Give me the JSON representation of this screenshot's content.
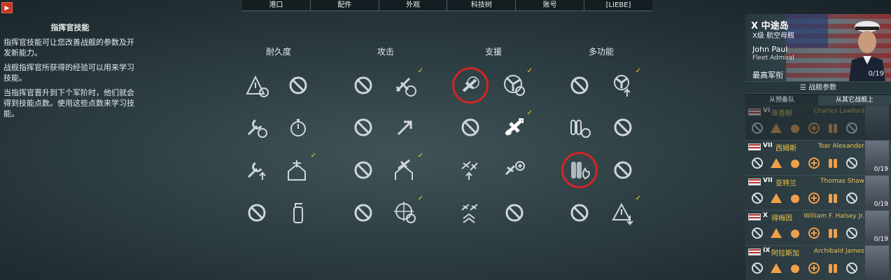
{
  "nav": {
    "back_icon": "▶",
    "tabs": [
      "港口",
      "配件",
      "外观",
      "科技树",
      "账号",
      "[LIEBE]"
    ]
  },
  "info": {
    "title": "指挥官技能",
    "p1": "指挥官技能可让您改善战舰的参数及开发新能力。",
    "p2": "战舰指挥官所获得的经验可以用来学习技能。",
    "p3": "当指挥官晋升到下个军阶时，他们就会得到技能点数。使用这些点数来学习技能。"
  },
  "columns": [
    "耐久度",
    "攻击",
    "支援",
    "多功能"
  ],
  "skills": [
    {
      "icon": "warning-radar-icon",
      "state": "available",
      "check": false
    },
    {
      "icon": "forbidden-icon",
      "state": "locked",
      "check": false
    },
    {
      "icon": "forbidden-icon",
      "state": "locked",
      "check": false
    },
    {
      "icon": "plane-attack-icon",
      "state": "available",
      "check": true
    },
    {
      "icon": "plane-circle-icon",
      "state": "selected",
      "check": false
    },
    {
      "icon": "propeller-icon",
      "state": "available",
      "check": true
    },
    {
      "icon": "forbidden-icon",
      "state": "locked",
      "check": false
    },
    {
      "icon": "propeller-up-icon",
      "state": "available",
      "check": true
    },
    {
      "icon": "wrench-timer-icon",
      "state": "available",
      "check": false
    },
    {
      "icon": "stopwatch-icon",
      "state": "available",
      "check": false
    },
    {
      "icon": "forbidden-icon",
      "state": "locked",
      "check": false
    },
    {
      "icon": "arrow-up-icon",
      "state": "available",
      "check": false
    },
    {
      "icon": "forbidden-icon",
      "state": "locked",
      "check": false
    },
    {
      "icon": "plane-highlight-icon",
      "state": "active",
      "check": true
    },
    {
      "icon": "shells-timer-icon",
      "state": "available",
      "check": false
    },
    {
      "icon": "forbidden-icon",
      "state": "locked",
      "check": false
    },
    {
      "icon": "wrench-up-icon",
      "state": "available",
      "check": false
    },
    {
      "icon": "aa-gun-house-icon",
      "state": "available",
      "check": true
    },
    {
      "icon": "forbidden-icon",
      "state": "locked",
      "check": false
    },
    {
      "icon": "plane-house-icon",
      "state": "available",
      "check": true
    },
    {
      "icon": "planes-up-icon",
      "state": "available",
      "check": false
    },
    {
      "icon": "planes-plus-icon",
      "state": "available",
      "check": false
    },
    {
      "icon": "fire-shells-icon",
      "state": "selected",
      "check": false
    },
    {
      "icon": "forbidden-icon",
      "state": "locked",
      "check": false
    },
    {
      "icon": "forbidden-icon",
      "state": "locked",
      "check": false
    },
    {
      "icon": "extinguisher-icon",
      "state": "available",
      "check": false
    },
    {
      "icon": "forbidden-icon",
      "state": "locked",
      "check": false
    },
    {
      "icon": "crosshair-timer-icon",
      "state": "available",
      "check": true
    },
    {
      "icon": "planes-chevron-icon",
      "state": "available",
      "check": false
    },
    {
      "icon": "forbidden-icon",
      "state": "locked",
      "check": false
    },
    {
      "icon": "forbidden-icon",
      "state": "locked",
      "check": false
    },
    {
      "icon": "warning-down-icon",
      "state": "available",
      "check": true
    }
  ],
  "commander": {
    "tier": "X",
    "ship": "中途岛",
    "ship_type": "X级 航空母舰",
    "name": "John Paul",
    "rank": "Fleet Admiral",
    "rank_label": "最高军衔",
    "points": "0/19"
  },
  "panel": {
    "params_label": "战舰参数",
    "tab_reserve": "从预备队",
    "tab_other": "从其它战舰上"
  },
  "reserve_rows": [
    {
      "tier": "VI",
      "ship": "珠香鲸",
      "commander": "Charles Lawford",
      "points": "",
      "dim": true
    },
    {
      "tier": "VII",
      "ship": "西姆斯",
      "commander": "Tsar Alexander",
      "points": "0/19",
      "dim": false
    },
    {
      "tier": "VII",
      "ship": "亚特兰",
      "commander": "Thomas Shaw",
      "points": "0/19",
      "dim": false
    },
    {
      "tier": "X",
      "ship": "得梅因",
      "commander": "William F. Halsey Jr.",
      "points": "0/19",
      "dim": false
    },
    {
      "tier": "IX",
      "ship": "阿拉斯加",
      "commander": "Archibald James",
      "points": "",
      "dim": false
    }
  ],
  "colors": {
    "accent_red": "#d42424",
    "check_yellow": "#f5d020",
    "name_gold": "#f0c64a"
  }
}
